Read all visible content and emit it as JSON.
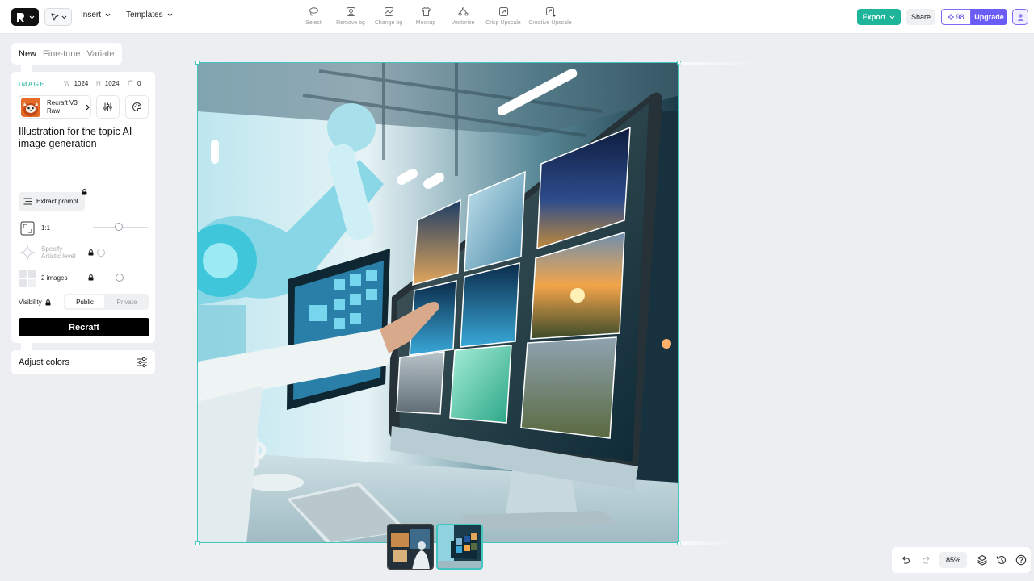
{
  "toolbar": {
    "menus": [
      {
        "label": "Insert"
      },
      {
        "label": "Templates"
      }
    ],
    "tools": [
      {
        "label": "Select",
        "icon": "lasso-icon"
      },
      {
        "label": "Remove bg",
        "icon": "remove-bg-icon"
      },
      {
        "label": "Change bg",
        "icon": "change-bg-icon"
      },
      {
        "label": "Mockup",
        "icon": "tshirt-icon"
      },
      {
        "label": "Vectorize",
        "icon": "vector-path-icon"
      },
      {
        "label": "Crisp Upscale",
        "icon": "crisp-upscale-icon"
      },
      {
        "label": "Creative Upscale",
        "icon": "creative-upscale-icon"
      }
    ],
    "export_label": "Export",
    "share_label": "Share",
    "credits": "98",
    "upgrade_label": "Upgrade"
  },
  "panel": {
    "tabs": [
      {
        "label": "New",
        "active": true
      },
      {
        "label": "Fine-tune",
        "active": false
      },
      {
        "label": "Variate",
        "active": false
      }
    ],
    "section_label": "IMAGE",
    "width_key": "W",
    "width": "1024",
    "height_key": "H",
    "height": "1024",
    "corner": "0",
    "model_name": "Recraft V3 Raw",
    "prompt": "Illustration for the topic AI image generation",
    "extract_label": "Extract prompt",
    "ratio_label": "1:1",
    "artistic_label_1": "Specify",
    "artistic_label_2": "Artistic level",
    "images_label": "2 images",
    "visibility_label": "Visibility",
    "public_label": "Public",
    "private_label": "Private",
    "recraft_label": "Recraft",
    "adjust_label": "Adjust colors"
  },
  "canvas": {
    "zoom": "85%"
  },
  "colors": {
    "accent": "#1fb59b",
    "upgrade": "#6a5cf5",
    "selection": "#43c6c0"
  }
}
